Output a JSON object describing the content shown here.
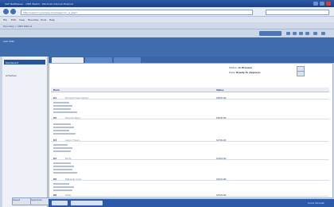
{
  "window": {
    "title": "SAP NetWeaver - CRM WebUI - Windows Internet Explorer"
  },
  "browser": {
    "address": "http://sapcrm.example.local/sap/crm_ui_start",
    "search_placeholder": ""
  },
  "menu": {
    "items": [
      "File",
      "Edit",
      "View",
      "Favorites",
      "Tools",
      "Help"
    ]
  },
  "breadcrumb": "Favorites  >  CRM Web UI",
  "blue_bar_title": "SAP CRM",
  "sidebar": {
    "items": [
      "Dashboard",
      "Activities"
    ],
    "footer_buttons": [
      "Saved",
      "Searches"
    ]
  },
  "record": {
    "fields": [
      {
        "label": "Status:",
        "value": "In Process"
      },
      {
        "label": "Date:",
        "value": "Ready to Approve"
      }
    ]
  },
  "table": {
    "columns": [
      "Item",
      "Value"
    ],
    "rows": [
      {
        "id": "01",
        "sub": "Product Description",
        "value": "$850.00"
      },
      {
        "id": "02",
        "sub": "Service Item",
        "value": "$820.00"
      },
      {
        "id": "03",
        "sub": "Labor Hours",
        "value": "$150.00"
      },
      {
        "id": "04",
        "sub": "Parts",
        "value": "$450.00"
      },
      {
        "id": "05",
        "sub": "Material Cost",
        "value": "$620.00"
      },
      {
        "id": "06",
        "sub": "Total",
        "value": "$550.00"
      }
    ]
  },
  "status_bar": {
    "text": "Local intranet"
  },
  "colors": {
    "accent": "#2c5aa8",
    "ribbon": "#3f6cad",
    "sidebar_active": "#27549b"
  },
  "icons": [
    "back-icon",
    "forward-icon",
    "close-icon",
    "minimize-icon",
    "maximize-icon"
  ]
}
